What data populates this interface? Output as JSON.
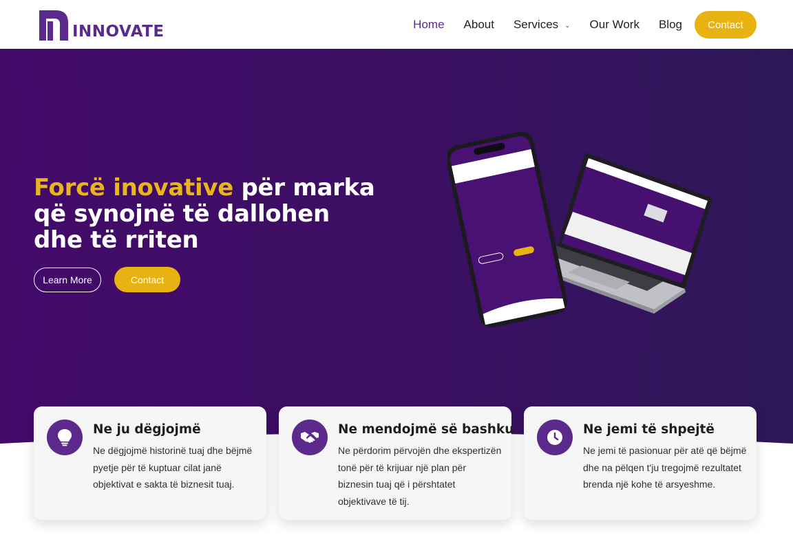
{
  "brand": {
    "name": "INNOVATE",
    "color": "#5a2a8c",
    "accent": "#e8b212"
  },
  "nav": {
    "home": "Home",
    "about": "About",
    "services": "Services",
    "our_work": "Our Work",
    "blog": "Blog",
    "contact": "Contact"
  },
  "hero": {
    "headline_accent": "Forcë inovative",
    "headline_rest": " për marka që synojnë të dallohen dhe të rriten",
    "learn_more": "Learn More",
    "contact": "Contact"
  },
  "cards": [
    {
      "icon": "lightbulb-icon",
      "title": "Ne ju dëgjojmë",
      "text": "Ne dëgjojmë historinë tuaj dhe bëjmë pyetje për të kuptuar cilat janë objektivat e sakta të biznesit tuaj."
    },
    {
      "icon": "handshake-icon",
      "title": "Ne mendojmë së bashku",
      "text": "Ne përdorim përvojën dhe ekspertizën tonë për të krijuar një plan për biznesin tuaj që i përshtatet objektivave të tij."
    },
    {
      "icon": "clock-icon",
      "title": "Ne jemi të shpejtë",
      "text": "Ne jemi të pasionuar për atë që bëjmë dhe na pëlqen t'ju tregojmë rezultatet brenda një kohe të arsyeshme."
    }
  ]
}
